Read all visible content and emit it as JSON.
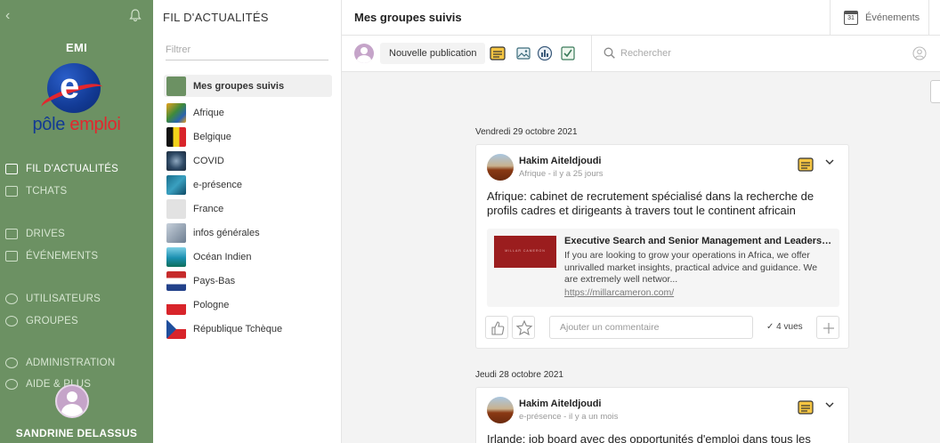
{
  "sidebar": {
    "org_name": "EMI",
    "logo_text_1": "pôle",
    "logo_text_2": "emploi",
    "items": [
      {
        "label": "FIL D'ACTUALITÉS",
        "icon": "news-feed-icon"
      },
      {
        "label": "TCHATS",
        "icon": "chat-icon"
      },
      {
        "label": "DRIVES",
        "icon": "folder-icon"
      },
      {
        "label": "ÉVÉNEMENTS",
        "icon": "calendar-icon"
      },
      {
        "label": "UTILISATEURS",
        "icon": "user-icon"
      },
      {
        "label": "GROUPES",
        "icon": "groups-icon"
      },
      {
        "label": "ADMINISTRATION",
        "icon": "gear-icon"
      },
      {
        "label": "AIDE & PLUS",
        "icon": "help-icon"
      }
    ],
    "user_name": "SANDRINE DELASSUS"
  },
  "groups_panel": {
    "title": "FIL D'ACTUALITÉS",
    "filter_placeholder": "Filtrer",
    "items": [
      {
        "label": "Mes groupes suivis"
      },
      {
        "label": "Afrique"
      },
      {
        "label": "Belgique"
      },
      {
        "label": "COVID"
      },
      {
        "label": "e-présence"
      },
      {
        "label": "France"
      },
      {
        "label": "infos générales"
      },
      {
        "label": "Océan Indien"
      },
      {
        "label": "Pays-Bas"
      },
      {
        "label": "Pologne"
      },
      {
        "label": "République Tchèque"
      }
    ]
  },
  "header": {
    "title": "Mes groupes suivis",
    "events_label": "Événements",
    "calendar_day": "31"
  },
  "toolbar": {
    "new_post_label": "Nouvelle publication",
    "search_placeholder": "Rechercher"
  },
  "feed": [
    {
      "date": "Vendredi 29 octobre 2021",
      "author": "Hakim Aiteldjoudi",
      "meta": "Afrique - il y a 25 jours",
      "body": "Afrique: cabinet de recrutement spécialisé dans la recherche de profils cadres et dirigeants à travers tout le continent africain",
      "link": {
        "title": "Executive Search and Senior Management and Leadership",
        "description": "If you are looking to grow your operations in Africa, we offer unrivalled market insights, practical advice and guidance. We are extremely well networ...",
        "url": "https://millarcameron.com/",
        "image_text": "MILLAR CAMERON"
      },
      "comment_placeholder": "Ajouter un commentaire",
      "views": "4 vues"
    },
    {
      "date": "Jeudi 28 octobre 2021",
      "author": "Hakim Aiteldjoudi",
      "meta": "e-présence - il y a un mois",
      "body": "Irlande: job board avec des opportunités d'emploi dans tous les"
    }
  ],
  "colors": {
    "sidebar_green": "#6c9163",
    "brand_blue": "#123a94",
    "brand_red": "#e3262d",
    "news_icon_yellow": "#f5c542"
  }
}
